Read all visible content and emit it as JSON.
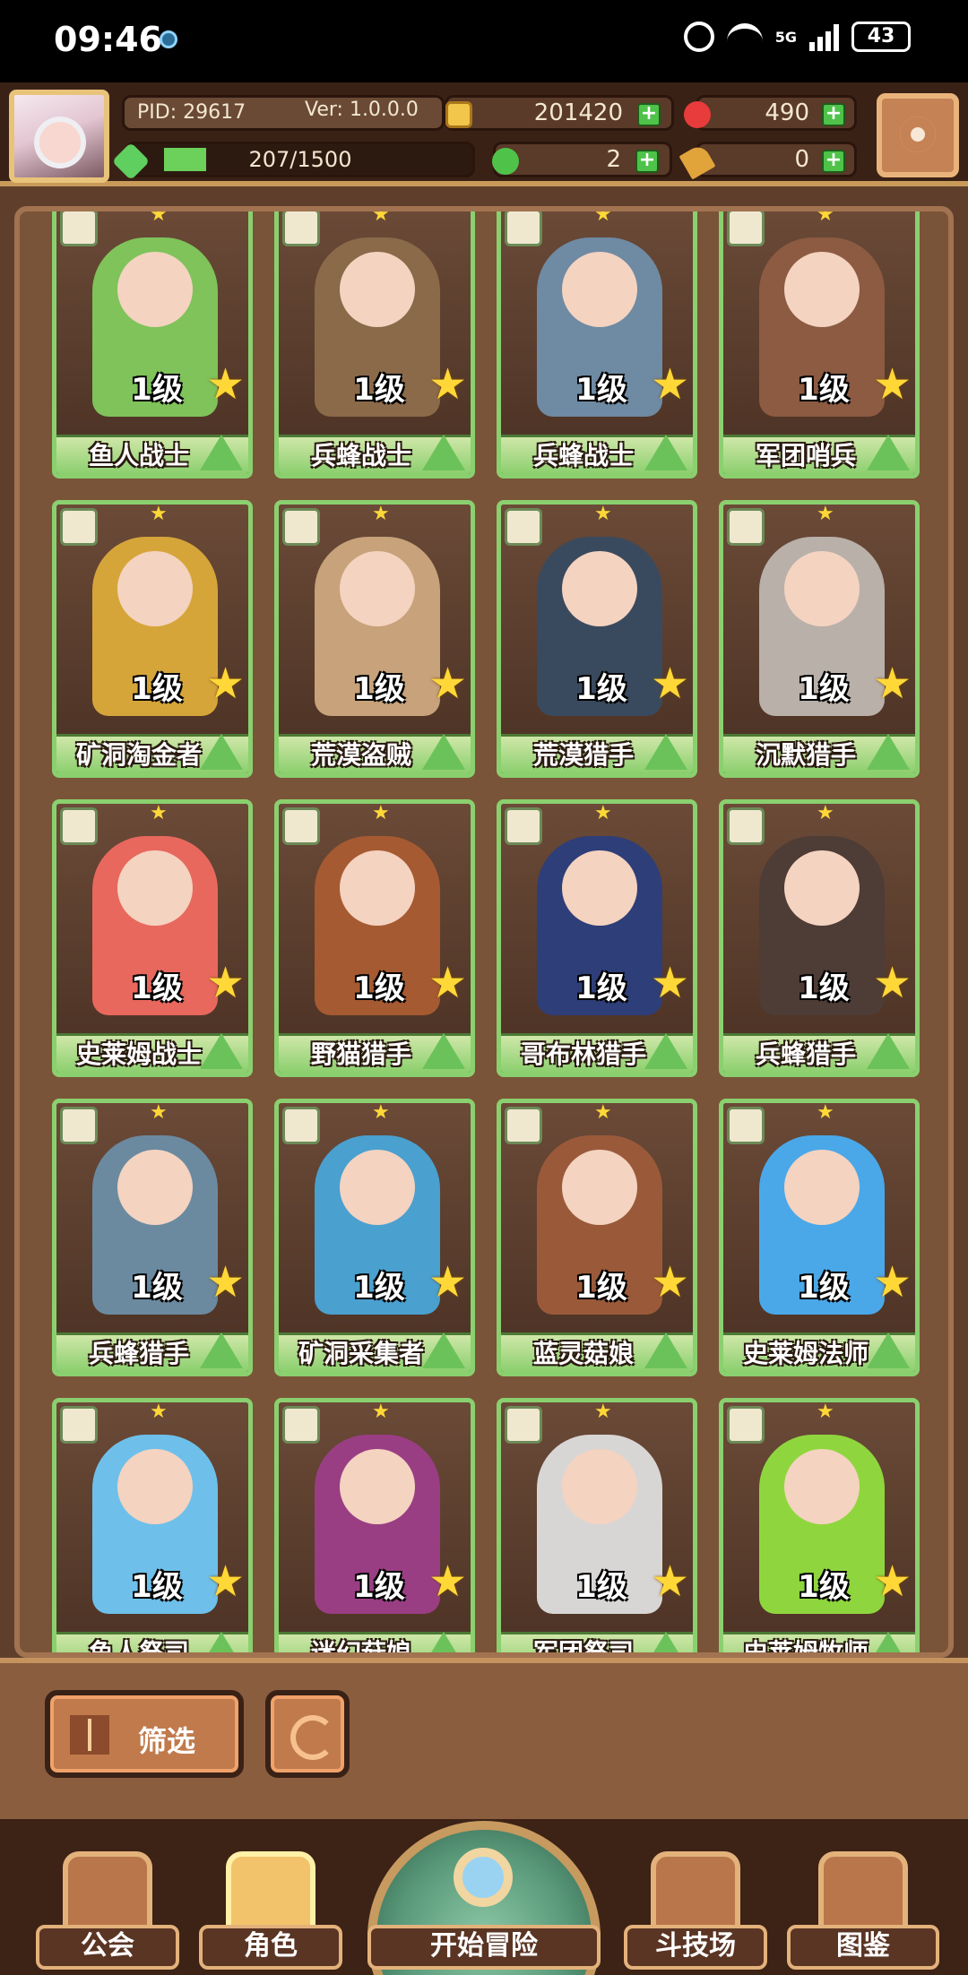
{
  "status_bar": {
    "time": "09:46",
    "network": "5G",
    "battery": "43"
  },
  "top_bar": {
    "pid": "PID: 29617",
    "version": "Ver: 1.0.0.0",
    "gold": "201420",
    "gems": "490",
    "exp": "207/1500",
    "exp_fraction": 0.138,
    "green_currency": "2",
    "keys": "0",
    "icons": {
      "gold": "gold-coin-icon",
      "gems": "red-gem-icon",
      "exp": "green-crystal-icon",
      "green_currency": "green-clover-icon",
      "keys": "key-icon",
      "settings": "gear-icon"
    }
  },
  "cards": [
    {
      "level": "1级",
      "name": "鱼人战士",
      "color": "#7fc35a"
    },
    {
      "level": "1级",
      "name": "兵蜂战士",
      "color": "#8b6a4a"
    },
    {
      "level": "1级",
      "name": "兵蜂战士",
      "color": "#6f8aa3"
    },
    {
      "level": "1级",
      "name": "军团哨兵",
      "color": "#8c5b42"
    },
    {
      "level": "1级",
      "name": "矿洞淘金者",
      "color": "#d6a53a"
    },
    {
      "level": "1级",
      "name": "荒漠盗贼",
      "color": "#c7a27a"
    },
    {
      "level": "1级",
      "name": "荒漠猎手",
      "color": "#3a4a5e"
    },
    {
      "level": "1级",
      "name": "沉默猎手",
      "color": "#b9b0aa"
    },
    {
      "level": "1级",
      "name": "史莱姆战士",
      "color": "#e8685e"
    },
    {
      "level": "1级",
      "name": "野猫猎手",
      "color": "#a65a32"
    },
    {
      "level": "1级",
      "name": "哥布林猎手",
      "color": "#2e3e78"
    },
    {
      "level": "1级",
      "name": "兵蜂猎手",
      "color": "#4e3c36"
    },
    {
      "level": "1级",
      "name": "兵蜂猎手",
      "color": "#6b8aa0"
    },
    {
      "level": "1级",
      "name": "矿洞采集者",
      "color": "#4aa0cf"
    },
    {
      "level": "1级",
      "name": "蓝灵菇娘",
      "color": "#9a5a3a"
    },
    {
      "level": "1级",
      "name": "史莱姆法师",
      "color": "#4aa8e8"
    },
    {
      "level": "1级",
      "name": "鱼人祭司",
      "color": "#6ec0ea"
    },
    {
      "level": "1级",
      "name": "迷幻菇娘",
      "color": "#9a3e84"
    },
    {
      "level": "1级",
      "name": "军团祭司",
      "color": "#d8d6d4"
    },
    {
      "level": "1级",
      "name": "史莱姆牧师",
      "color": "#8fd63e"
    }
  ],
  "filter": {
    "filter_label": "筛选",
    "filter_icon": "grid-icon",
    "refresh_icon": "refresh-icon"
  },
  "nav": {
    "guild": "公会",
    "characters": "角色",
    "adventure": "开始冒险",
    "arena": "斗技场",
    "codex": "图鉴"
  }
}
